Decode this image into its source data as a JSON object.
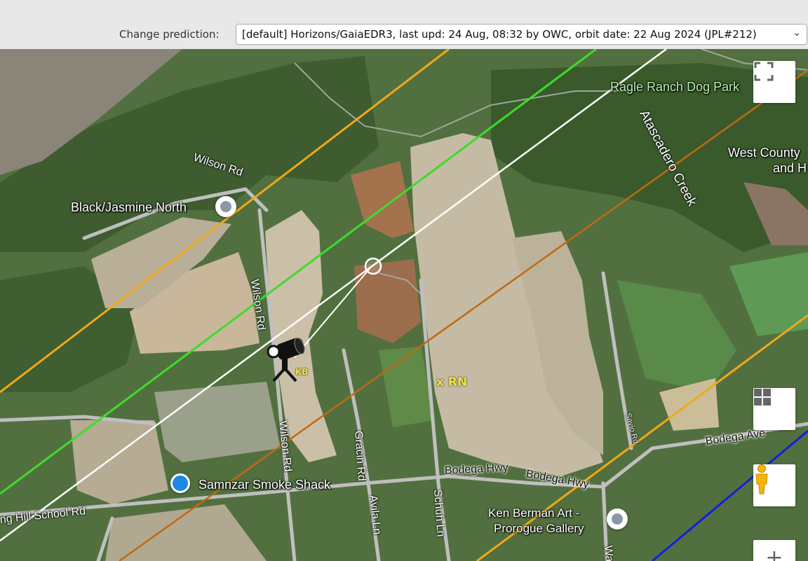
{
  "toolbar": {
    "prediction_label": "Change prediction:",
    "prediction_value": "[default] Horizons/GaiaEDR3, last upd: 24 Aug, 08:32 by OWC, orbit date: 22 Aug 2024 (JPL#212)"
  },
  "map": {
    "places": [
      {
        "name": "Ragle Ranch Dog Park"
      },
      {
        "name": "West County"
      },
      {
        "name": "and H"
      },
      {
        "name": "Black/Jasmine North"
      },
      {
        "name": "Samnzar Smoke Shack"
      },
      {
        "name": "Ken Berman Art -"
      },
      {
        "name": "Prorogue Gallery"
      }
    ],
    "roads": [
      {
        "name": "Wilson Rd"
      },
      {
        "name": "Wilson Rd"
      },
      {
        "name": "Wilson Rd"
      },
      {
        "name": "Atascadero Creek"
      },
      {
        "name": "Gracin Rd"
      },
      {
        "name": "Avila Ln"
      },
      {
        "name": "Schuh Ln"
      },
      {
        "name": "Bodega Hwy"
      },
      {
        "name": "Bodega Hwy"
      },
      {
        "name": "Bodega Ave"
      },
      {
        "name": "Savio Rd"
      },
      {
        "name": "ng Hill School Rd"
      },
      {
        "name": "Wa"
      }
    ],
    "observers": [
      {
        "code": "KB"
      },
      {
        "code": "x RN"
      }
    ],
    "controls": {
      "fullscreen": "fullscreen-icon",
      "layers": "layers-grid-icon",
      "streetview": "pegman-icon",
      "zoom_in": "+"
    },
    "line_colors": {
      "orange_limit": "#f0a818",
      "green_limit": "#3ddc2c",
      "center_line": "#ffffff",
      "brown_line": "#c06a10",
      "blue_line": "#1020e0"
    }
  }
}
